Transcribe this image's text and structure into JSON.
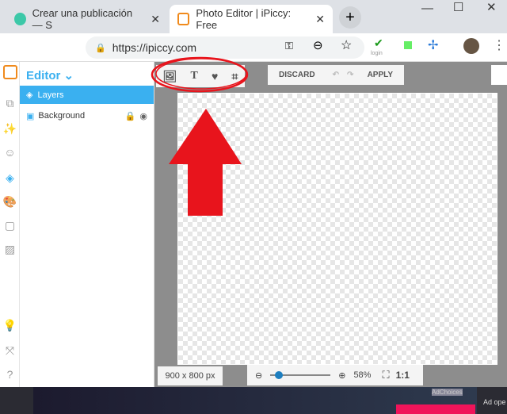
{
  "browser": {
    "tabs": [
      {
        "title": "Crear una publicación — S",
        "active": false
      },
      {
        "title": "Photo Editor | iPiccy: Free",
        "active": true
      }
    ],
    "url": "https://ipiccy.com",
    "extension_label": "login"
  },
  "editor": {
    "title": "Editor",
    "layers_header": "Layers",
    "layers": [
      {
        "name": "Background"
      }
    ]
  },
  "toolbar": {
    "discard": "DISCARD",
    "apply": "APPLY"
  },
  "status": {
    "dimensions": "900 x 800 px",
    "zoom": "58%",
    "zoom_level": 0.1,
    "actual_size": "1:1"
  },
  "ad": {
    "adchoices": "AdChoices",
    "side_text": "Ad ope"
  },
  "colors": {
    "accent": "#3ab0f0",
    "annotation": "#e8141c"
  }
}
